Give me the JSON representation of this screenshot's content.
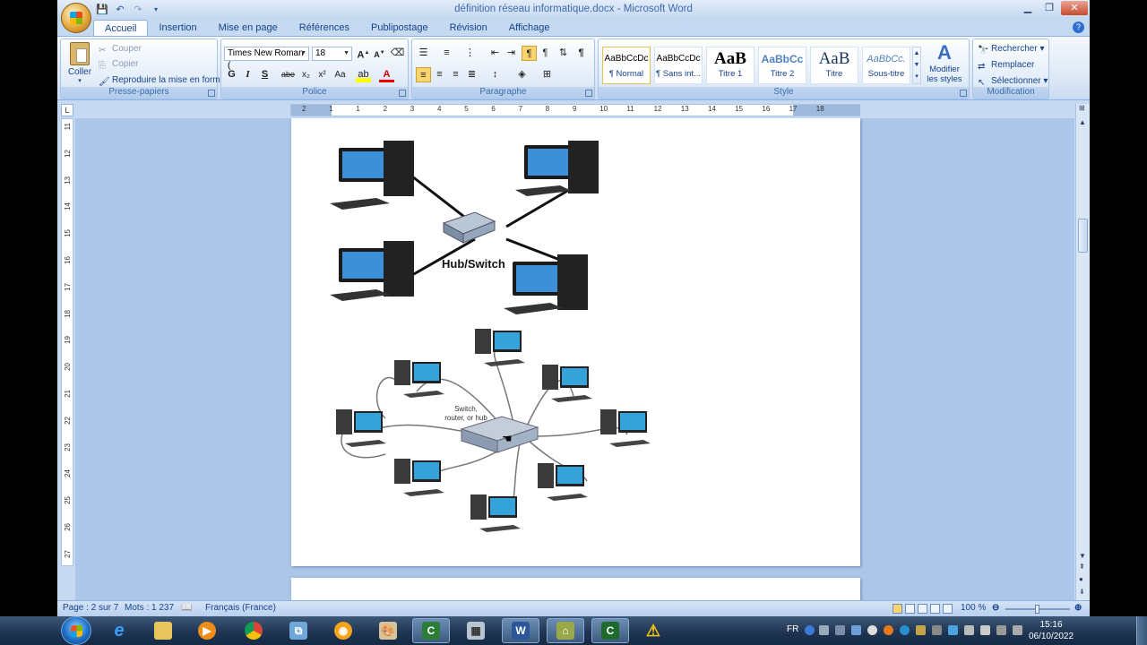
{
  "window": {
    "title": "définition réseau informatique.docx - Microsoft Word"
  },
  "tabs": [
    {
      "label": "Accueil",
      "active": true
    },
    {
      "label": "Insertion"
    },
    {
      "label": "Mise en page"
    },
    {
      "label": "Références"
    },
    {
      "label": "Publipostage"
    },
    {
      "label": "Révision"
    },
    {
      "label": "Affichage"
    }
  ],
  "ribbon": {
    "clipboard": {
      "label": "Presse-papiers",
      "paste": "Coller",
      "cut": "Couper",
      "copy": "Copier",
      "format_painter": "Reproduire la mise en forme"
    },
    "font": {
      "label": "Police",
      "font_name": "Times New Roman (",
      "font_size": "18",
      "bold": "G",
      "italic": "I",
      "underline": "S",
      "strike": "abe",
      "subscript": "x₂",
      "superscript": "x²",
      "case": "Aa"
    },
    "paragraph": {
      "label": "Paragraphe"
    },
    "styles": {
      "label": "Style",
      "items": [
        {
          "sample": "AaBbCcDc",
          "name": "¶ Normal"
        },
        {
          "sample": "AaBbCcDc",
          "name": "¶ Sans int..."
        },
        {
          "sample": "AaB",
          "name": "Titre 1"
        },
        {
          "sample": "AaBbCc",
          "name": "Titre 2"
        },
        {
          "sample": "AaB",
          "name": "Titre"
        },
        {
          "sample": "AaBbCc.",
          "name": "Sous-titre"
        }
      ],
      "change_styles": "Modifier les styles"
    },
    "editing": {
      "label": "Modification",
      "find": "Rechercher",
      "replace": "Remplacer",
      "select": "Sélectionner"
    }
  },
  "ruler": {
    "h_ticks": [
      "2",
      "1",
      "1",
      "2",
      "3",
      "4",
      "5",
      "6",
      "7",
      "8",
      "9",
      "10",
      "11",
      "12",
      "13",
      "14",
      "15",
      "16",
      "17",
      "18"
    ],
    "v_ticks": [
      "11",
      "12",
      "13",
      "14",
      "15",
      "16",
      "17",
      "18",
      "19",
      "20",
      "21",
      "22",
      "23",
      "24",
      "25",
      "26",
      "27"
    ]
  },
  "document": {
    "figure1_label": "Hub/Switch",
    "figure2_label": "Switch,\nrouter, or hub"
  },
  "statusbar": {
    "page": "Page : 2 sur 7",
    "words": "Mots : 1 237",
    "language": "Français (France)",
    "zoom": "100 %"
  },
  "taskbar": {
    "language": "FR",
    "time": "15:16",
    "date": "06/10/2022"
  },
  "colors": {
    "ribbon_bg": "#dbe7f6",
    "doc_bg": "#abc6e8",
    "taskbar": "#1d3350"
  }
}
